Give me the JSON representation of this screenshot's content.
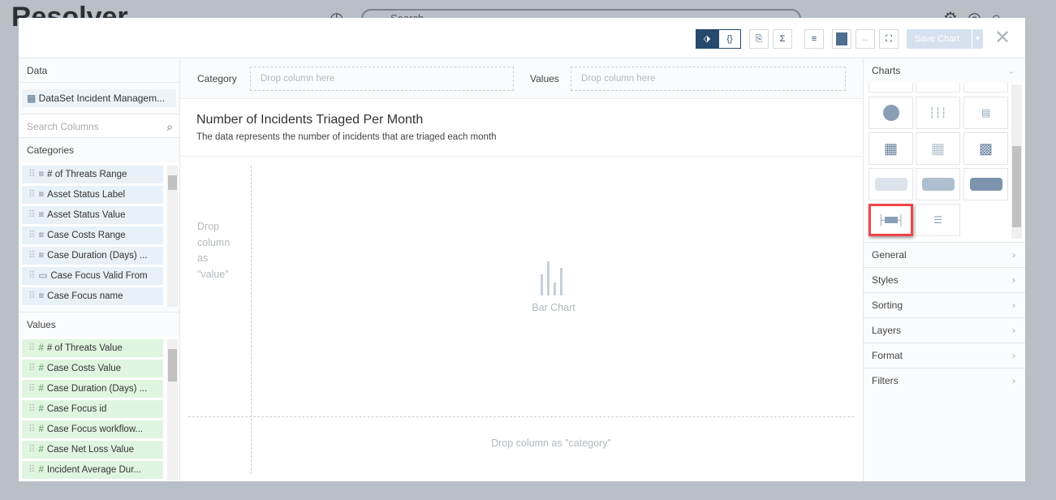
{
  "background": {
    "logo": "Resolver",
    "search_placeholder": "Search"
  },
  "toolbar": {
    "tag_label": "⬗",
    "code_label": "{}",
    "save_chart": "Save Chart",
    "close": "✕"
  },
  "left": {
    "data_header": "Data",
    "dataset": "DataSet Incident Managem...",
    "search_placeholder": "Search Columns",
    "categories_header": "Categories",
    "categories": [
      {
        "label": "# of Threats Range",
        "type": "text"
      },
      {
        "label": "Asset Status Label",
        "type": "text"
      },
      {
        "label": "Asset Status Value",
        "type": "text"
      },
      {
        "label": "Case Costs Range",
        "type": "text"
      },
      {
        "label": "Case Duration (Days) ...",
        "type": "text"
      },
      {
        "label": "Case Focus Valid From",
        "type": "date"
      },
      {
        "label": "Case Focus name",
        "type": "text"
      }
    ],
    "values_header": "Values",
    "values": [
      "# of Threats Value",
      "Case Costs Value",
      "Case Duration (Days) ...",
      "Case Focus id",
      "Case Focus workflow...",
      "Case Net Loss Value",
      "Incident Average Dur..."
    ]
  },
  "center": {
    "category_label": "Category",
    "category_drop": "Drop column here",
    "values_label": "Values",
    "values_drop": "Drop column here",
    "title": "Number of Incidents Triaged Per Month",
    "description": "The data represents the number of incidents that are triaged each month",
    "drop_value": "Drop column as \"value\"",
    "chart_type": "Bar Chart",
    "drop_category": "Drop column as \"category\""
  },
  "right": {
    "charts_header": "Charts",
    "sections": [
      "General",
      "Styles",
      "Sorting",
      "Layers",
      "Format",
      "Filters"
    ]
  }
}
